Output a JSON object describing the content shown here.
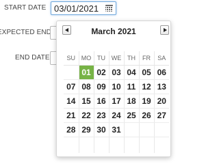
{
  "form": {
    "start_date_label": "START DATE",
    "expected_end_date_label": "EXPECTED END DATE",
    "end_date_label": "END DATE",
    "start_date_value": "03/01/2021"
  },
  "icons": {
    "calendar": "calendar-icon",
    "prev": "chevron-left-icon",
    "next": "chevron-right-icon"
  },
  "colors": {
    "selected_day_bg": "#77b346",
    "focus_border": "#6fa8dc"
  },
  "calendar": {
    "month_label": "March 2021",
    "weekdays": [
      "SU",
      "MO",
      "TU",
      "WE",
      "TH",
      "FR",
      "SA"
    ],
    "selected_day": "01",
    "weeks": [
      [
        "",
        "01",
        "02",
        "03",
        "04",
        "05",
        "06"
      ],
      [
        "07",
        "08",
        "09",
        "10",
        "11",
        "12",
        "13"
      ],
      [
        "14",
        "15",
        "16",
        "17",
        "18",
        "19",
        "20"
      ],
      [
        "21",
        "22",
        "23",
        "24",
        "25",
        "26",
        "27"
      ],
      [
        "28",
        "29",
        "30",
        "31",
        "",
        "",
        ""
      ]
    ]
  }
}
